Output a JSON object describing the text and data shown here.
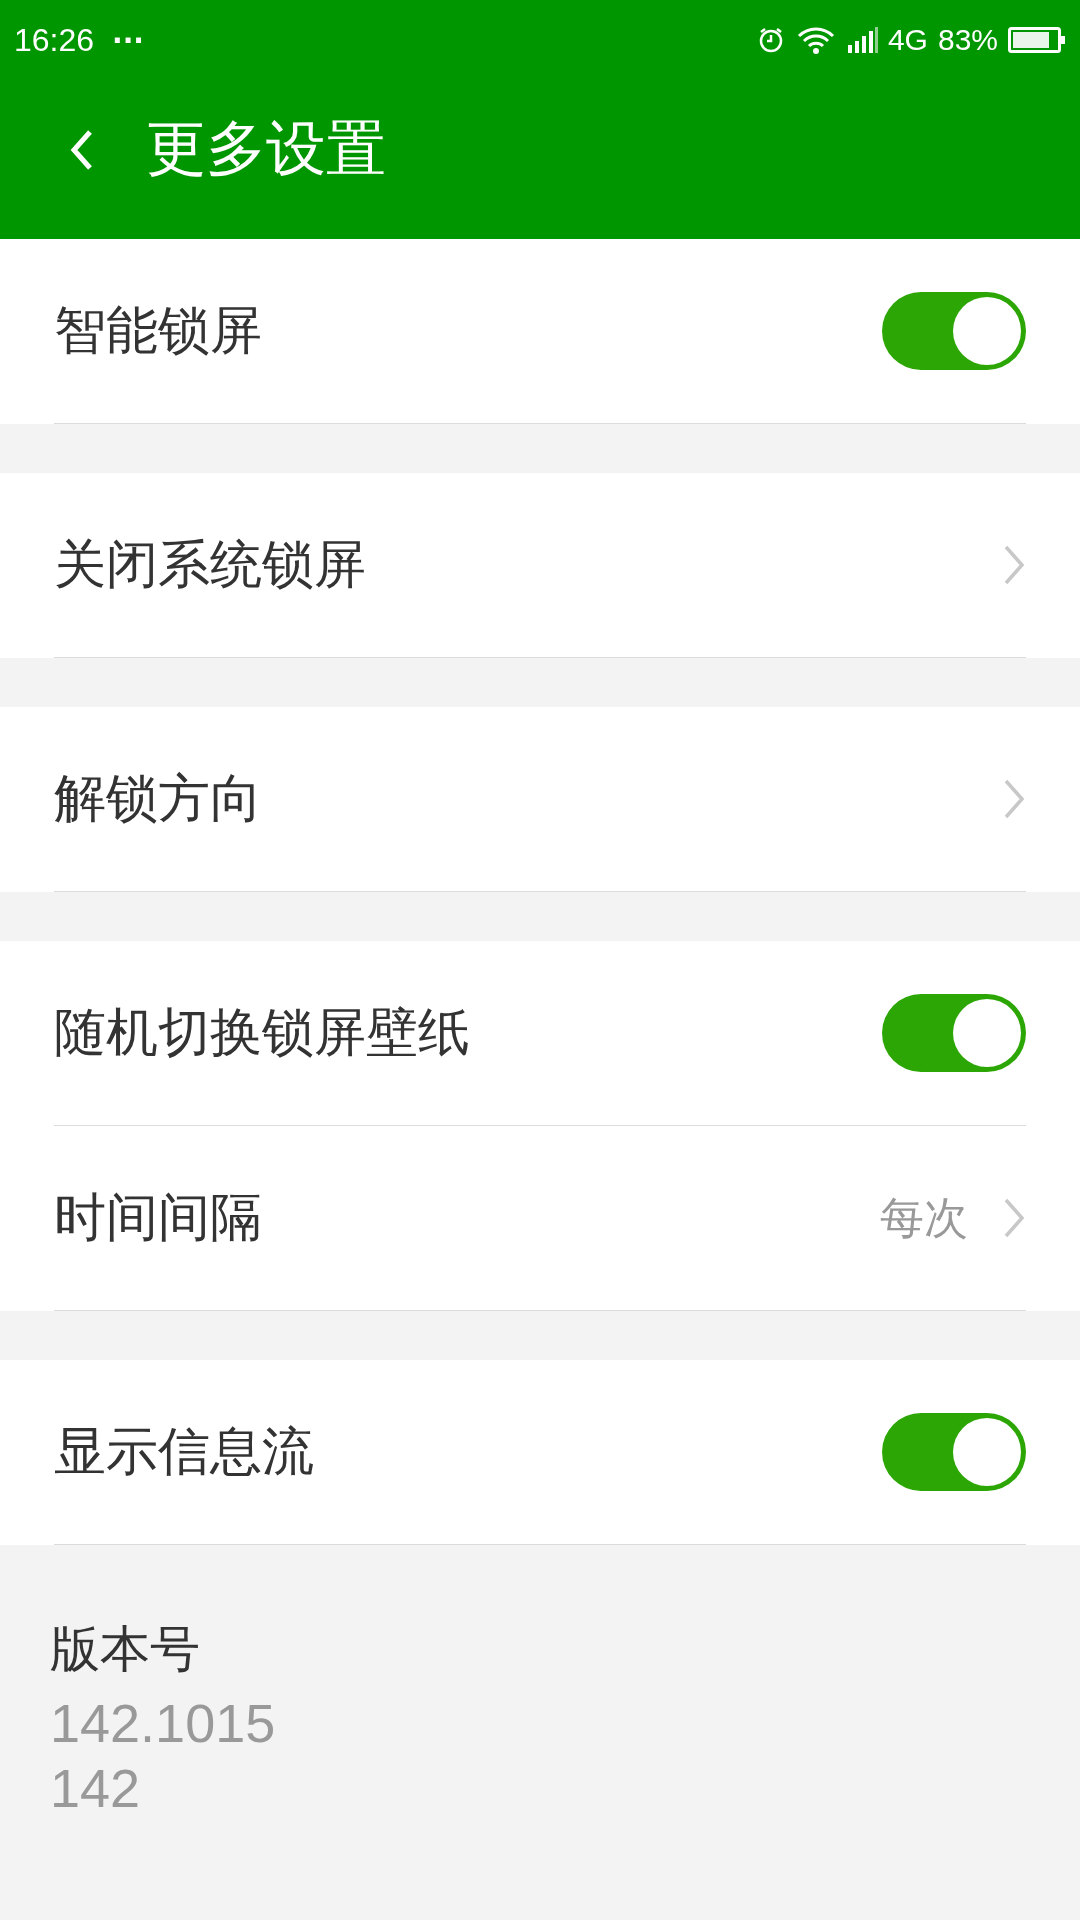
{
  "status_bar": {
    "time": "16:26",
    "more": "···",
    "network": "4G",
    "battery": "83%"
  },
  "app_bar": {
    "title": "更多设置"
  },
  "groups": [
    {
      "items": [
        {
          "kind": "toggle",
          "label": "智能锁屏",
          "on": true
        }
      ]
    },
    {
      "items": [
        {
          "kind": "link",
          "label": "关闭系统锁屏"
        }
      ]
    },
    {
      "items": [
        {
          "kind": "link",
          "label": "解锁方向"
        }
      ]
    },
    {
      "items": [
        {
          "kind": "toggle",
          "label": "随机切换锁屏壁纸",
          "on": true
        },
        {
          "kind": "link",
          "label": "时间间隔",
          "value": "每次"
        }
      ]
    },
    {
      "items": [
        {
          "kind": "toggle",
          "label": "显示信息流",
          "on": true
        }
      ]
    }
  ],
  "version": {
    "label": "版本号",
    "lines": [
      "142.1015",
      "142"
    ]
  }
}
